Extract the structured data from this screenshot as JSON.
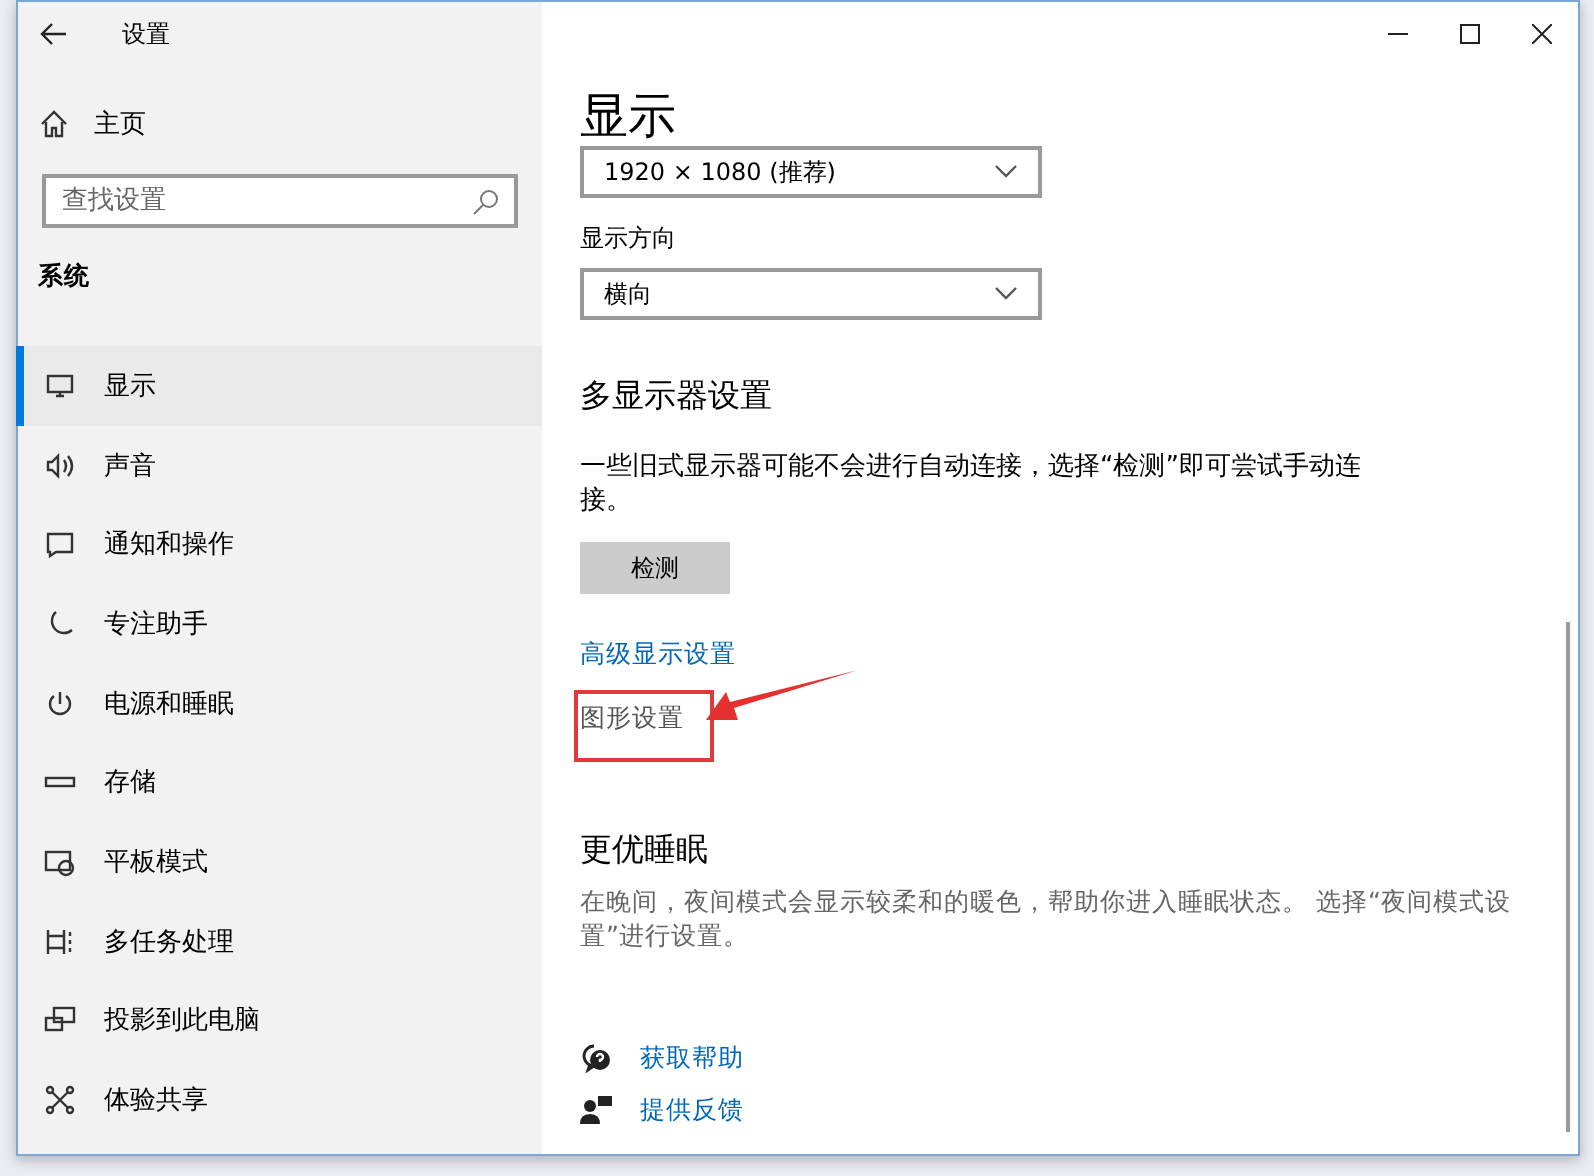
{
  "window": {
    "title": "设置"
  },
  "sidebar": {
    "home": "主页",
    "search": {
      "placeholder": "查找设置"
    },
    "section": "系统",
    "items": [
      {
        "label": "显示",
        "selected": true
      },
      {
        "label": "声音",
        "selected": false
      },
      {
        "label": "通知和操作",
        "selected": false
      },
      {
        "label": "专注助手",
        "selected": false
      },
      {
        "label": "电源和睡眠",
        "selected": false
      },
      {
        "label": "存储",
        "selected": false
      },
      {
        "label": "平板模式",
        "selected": false
      },
      {
        "label": "多任务处理",
        "selected": false
      },
      {
        "label": "投影到此电脑",
        "selected": false
      },
      {
        "label": "体验共享",
        "selected": false
      }
    ]
  },
  "content": {
    "title": "显示",
    "resolution": {
      "value": "1920 × 1080 (推荐)"
    },
    "orientation": {
      "label": "显示方向",
      "value": "横向"
    },
    "multi_display": {
      "heading": "多显示器设置",
      "text": "一些旧式显示器可能不会进行自动连接，选择“检测”即可尝试手动连接。",
      "button": "检测"
    },
    "links": [
      {
        "text": "高级显示设置",
        "kind": "link",
        "highlighted": false
      },
      {
        "text": "图形设置",
        "kind": "plain",
        "highlighted": true
      }
    ],
    "sleep": {
      "heading": "更优睡眠",
      "text": "在晚间，夜间模式会显示较柔和的暖色，帮助你进入睡眠状态。 选择“夜间模式设置”进行设置。"
    },
    "help": [
      {
        "text": "获取帮助"
      },
      {
        "text": "提供反馈"
      }
    ]
  }
}
